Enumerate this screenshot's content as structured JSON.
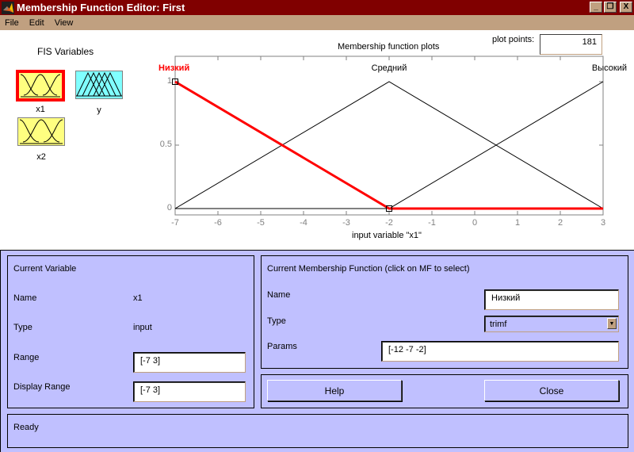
{
  "window": {
    "title": "Membership Function Editor: First",
    "buttons": [
      "_",
      "❐",
      "X"
    ]
  },
  "menu": [
    "File",
    "Edit",
    "View"
  ],
  "fis": {
    "title": "FIS Variables",
    "variables": [
      {
        "name": "x1",
        "kind": "input",
        "selected": true,
        "color": "#ffff80"
      },
      {
        "name": "y",
        "kind": "output",
        "selected": false,
        "color": "#80ffff"
      },
      {
        "name": "x2",
        "kind": "input",
        "selected": false,
        "color": "#ffff80"
      }
    ]
  },
  "plot": {
    "title": "Membership function plots",
    "plot_points_label": "plot points:",
    "plot_points_value": "181"
  },
  "chart_data": {
    "type": "line",
    "title": "Membership function plots",
    "xlabel": "input variable \"x1\"",
    "ylabel": "",
    "xlim": [
      -7,
      3
    ],
    "ylim": [
      0,
      1
    ],
    "xticks": [
      -7,
      -6,
      -5,
      -4,
      -3,
      -2,
      -1,
      0,
      1,
      2,
      3
    ],
    "xtick_labels": [
      "-7",
      "-6",
      "-5",
      "-4",
      "-3",
      "-2",
      "-1",
      "0",
      "1",
      "2",
      "3"
    ],
    "yticks": [
      0,
      0.5,
      1
    ],
    "ytick_labels": [
      "0",
      "0.5",
      "1"
    ],
    "selected_series": "Низкий",
    "series": [
      {
        "name": "Низкий",
        "mf_type": "trimf",
        "params": [
          -12,
          -7,
          -2
        ],
        "x": [
          -7,
          -2,
          3
        ],
        "y": [
          1,
          0,
          0
        ],
        "color": "#ff0000",
        "label_x": -7
      },
      {
        "name": "Средний",
        "mf_type": "trimf",
        "params": [
          -7,
          -2,
          3
        ],
        "x": [
          -7,
          -2,
          3
        ],
        "y": [
          0,
          1,
          0
        ],
        "color": "#000000",
        "label_x": -2
      },
      {
        "name": "Высокий",
        "mf_type": "trimf",
        "params": [
          -2,
          3,
          8
        ],
        "x": [
          -7,
          -2,
          3
        ],
        "y": [
          0,
          0,
          1
        ],
        "color": "#000000",
        "label_x": 3
      }
    ]
  },
  "current_variable": {
    "title": "Current Variable",
    "name_label": "Name",
    "name_value": "x1",
    "type_label": "Type",
    "type_value": "input",
    "range_label": "Range",
    "range_value": "[-7 3]",
    "display_range_label": "Display Range",
    "display_range_value": "[-7 3]"
  },
  "current_mf": {
    "title": "Current Membership Function (click on MF to select)",
    "name_label": "Name",
    "name_value": "Низкий",
    "type_label": "Type",
    "type_value": "trimf",
    "params_label": "Params",
    "params_value": "[-12 -7 -2]"
  },
  "buttons": {
    "help": "Help",
    "close": "Close"
  },
  "status": "Ready"
}
